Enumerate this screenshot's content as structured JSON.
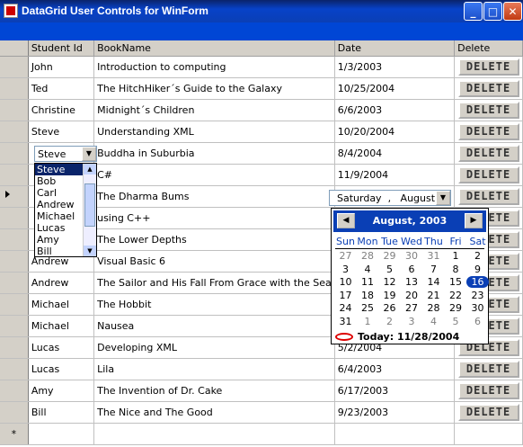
{
  "window": {
    "title": "DataGrid User Controls for WinForm",
    "minimize_glyph": "_",
    "maximize_glyph": "□",
    "close_glyph": "✕"
  },
  "grid": {
    "columns": [
      "Student Id",
      "BookName",
      "Date",
      "Delete"
    ],
    "delete_label": "DELETE",
    "new_row_marker": "*",
    "rows": [
      {
        "student": "John",
        "book": "Introduction to computing",
        "date": "1/3/2003"
      },
      {
        "student": "Ted",
        "book": "The HitchHiker´s Guide to the Galaxy",
        "date": "10/25/2004"
      },
      {
        "student": "Christine",
        "book": "Midnight´s Children",
        "date": "6/6/2003"
      },
      {
        "student": "Steve",
        "book": "Understanding XML",
        "date": "10/20/2004"
      },
      {
        "student": "",
        "book": "Buddha in Suburbia",
        "date": "8/4/2004"
      },
      {
        "student": "",
        "book": "C#",
        "date": "11/9/2004"
      },
      {
        "student": "",
        "book": "The Dharma Bums",
        "date": ""
      },
      {
        "student": "",
        "book": "using C++",
        "date": "5"
      },
      {
        "student": "",
        "book": "The Lower Depths",
        "date": "7"
      },
      {
        "student": "Andrew",
        "book": "Visual Basic 6",
        "date": "4"
      },
      {
        "student": "Andrew",
        "book": "The Sailor and His Fall From Grace with the Sea",
        "date": "6"
      },
      {
        "student": "Michael",
        "book": "The Hobbit",
        "date": "6"
      },
      {
        "student": "Michael",
        "book": "Nausea",
        "date": "3"
      },
      {
        "student": "Lucas",
        "book": "Developing XML",
        "date": "5/2/2004"
      },
      {
        "student": "Lucas",
        "book": "Lila",
        "date": "6/4/2003"
      },
      {
        "student": "Amy",
        "book": "The Invention of Dr. Cake",
        "date": "6/17/2003"
      },
      {
        "student": "Bill",
        "book": "The Nice and The Good",
        "date": "9/23/2003"
      }
    ]
  },
  "student_combo": {
    "value": "Steve",
    "dropdown_glyph": "▼",
    "options": [
      "Steve",
      "Bob",
      "Carl",
      "Andrew",
      "Michael",
      "Lucas",
      "Amy",
      "Bill"
    ],
    "selected_index": 0
  },
  "date_picker": {
    "value": "Saturday  ,   August",
    "dropdown_glyph": "▼"
  },
  "calendar": {
    "month_label": "August, 2003",
    "prev_glyph": "◀",
    "next_glyph": "▶",
    "weekdays": [
      "Sun",
      "Mon",
      "Tue",
      "Wed",
      "Thu",
      "Fri",
      "Sat"
    ],
    "weeks": [
      [
        "27",
        "28",
        "29",
        "30",
        "31",
        "1",
        "2"
      ],
      [
        "3",
        "4",
        "5",
        "6",
        "7",
        "8",
        "9"
      ],
      [
        "10",
        "11",
        "12",
        "13",
        "14",
        "15",
        "16"
      ],
      [
        "17",
        "18",
        "19",
        "20",
        "21",
        "22",
        "23"
      ],
      [
        "24",
        "25",
        "26",
        "27",
        "28",
        "29",
        "30"
      ],
      [
        "31",
        "1",
        "2",
        "3",
        "4",
        "5",
        "6"
      ]
    ],
    "selected_day": "16",
    "today_label": "Today: 11/28/2004",
    "accent_color": "#0a3fb5"
  }
}
